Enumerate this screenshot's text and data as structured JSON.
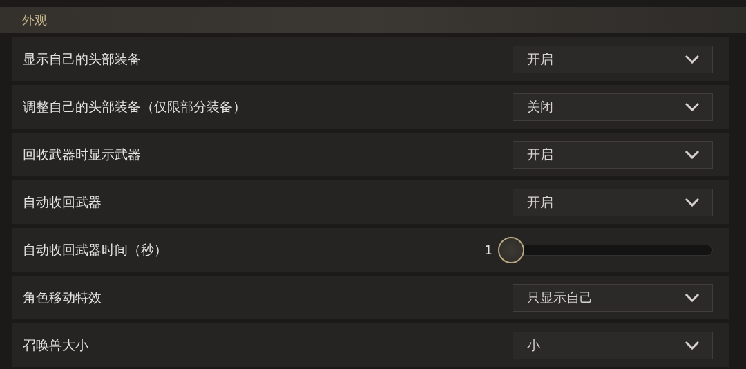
{
  "section": {
    "title": "外观"
  },
  "settings": [
    {
      "kind": "dropdown",
      "label": "显示自己的头部装备",
      "value": "开启"
    },
    {
      "kind": "dropdown",
      "label": "调整自己的头部装备（仅限部分装备）",
      "value": "关闭"
    },
    {
      "kind": "dropdown",
      "label": "回收武器时显示武器",
      "value": "开启"
    },
    {
      "kind": "dropdown",
      "label": "自动收回武器",
      "value": "开启"
    },
    {
      "kind": "slider",
      "label": "自动收回武器时间（秒）",
      "reading": "1",
      "level": 0
    },
    {
      "kind": "dropdown",
      "label": "角色移动特效",
      "value": "只显示自己"
    },
    {
      "kind": "dropdown",
      "label": "召唤兽大小",
      "value": "小"
    }
  ]
}
